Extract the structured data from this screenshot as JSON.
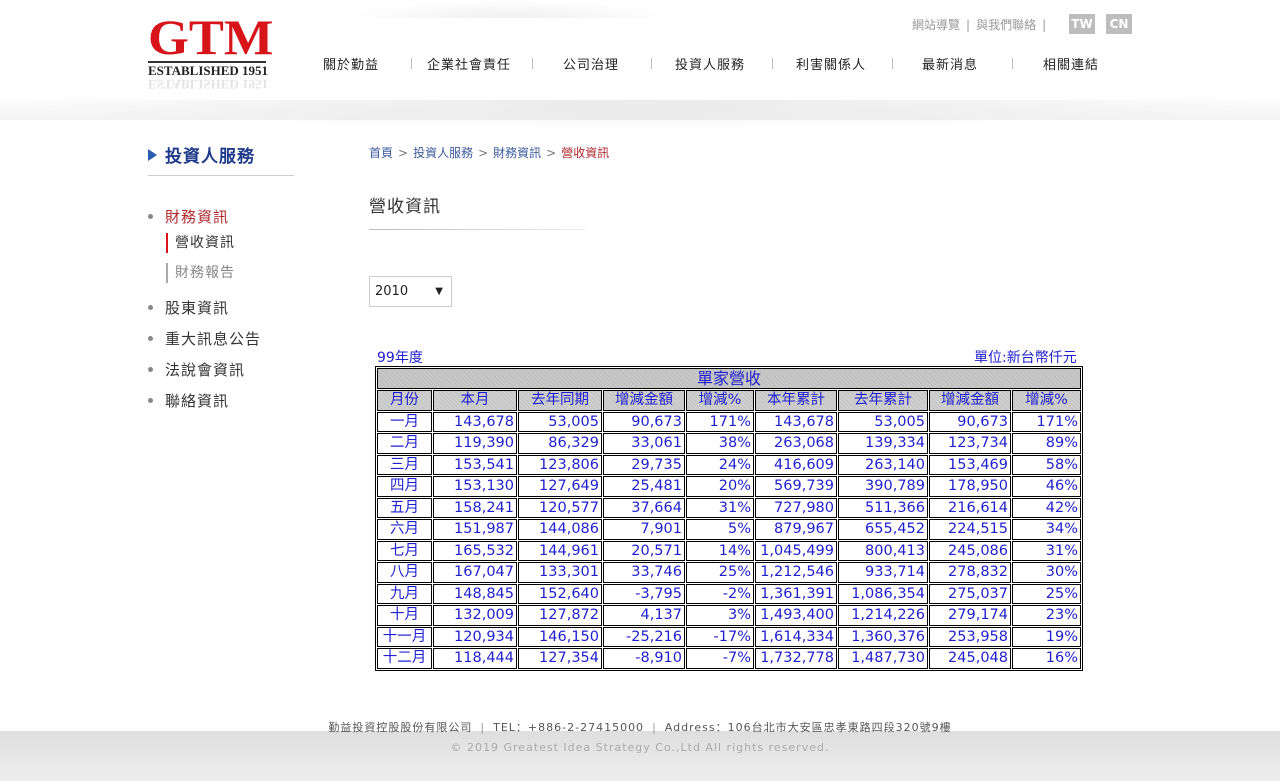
{
  "logo": {
    "text": "GTM",
    "sub": "ESTABLISHED 1951"
  },
  "header": {
    "links": [
      "網站導覽",
      "與我們聯絡"
    ],
    "lang": [
      "TW",
      "CN"
    ],
    "nav": [
      "關於勤益",
      "企業社會責任",
      "公司治理",
      "投資人服務",
      "利害關係人",
      "最新消息",
      "相關連結"
    ]
  },
  "sidebar": {
    "title": "投資人服務",
    "items": [
      {
        "label": "財務資訊"
      },
      {
        "label": "股東資訊"
      },
      {
        "label": "重大訊息公告"
      },
      {
        "label": "法說會資訊"
      },
      {
        "label": "聯絡資訊"
      }
    ],
    "subitems": [
      {
        "label": "營收資訊"
      },
      {
        "label": "財務報告"
      }
    ]
  },
  "breadcrumb": [
    "首頁",
    "投資人服務",
    "財務資訊",
    "營收資訊"
  ],
  "page_title": "營收資訊",
  "year_select": {
    "value": "2010"
  },
  "table": {
    "year_label": "99年度",
    "unit": "單位:新台幣仟元",
    "caption": "單家營收",
    "headers": [
      "月份",
      "本月",
      "去年同期",
      "增減金額",
      "增減%",
      "本年累計",
      "去年累計",
      "增減金額",
      "增減%"
    ],
    "rows": [
      [
        "一月",
        "143,678",
        "53,005",
        "90,673",
        "171%",
        "143,678",
        "53,005",
        "90,673",
        "171%"
      ],
      [
        "二月",
        "119,390",
        "86,329",
        "33,061",
        "38%",
        "263,068",
        "139,334",
        "123,734",
        "89%"
      ],
      [
        "三月",
        "153,541",
        "123,806",
        "29,735",
        "24%",
        "416,609",
        "263,140",
        "153,469",
        "58%"
      ],
      [
        "四月",
        "153,130",
        "127,649",
        "25,481",
        "20%",
        "569,739",
        "390,789",
        "178,950",
        "46%"
      ],
      [
        "五月",
        "158,241",
        "120,577",
        "37,664",
        "31%",
        "727,980",
        "511,366",
        "216,614",
        "42%"
      ],
      [
        "六月",
        "151,987",
        "144,086",
        "7,901",
        "5%",
        "879,967",
        "655,452",
        "224,515",
        "34%"
      ],
      [
        "七月",
        "165,532",
        "144,961",
        "20,571",
        "14%",
        "1,045,499",
        "800,413",
        "245,086",
        "31%"
      ],
      [
        "八月",
        "167,047",
        "133,301",
        "33,746",
        "25%",
        "1,212,546",
        "933,714",
        "278,832",
        "30%"
      ],
      [
        "九月",
        "148,845",
        "152,640",
        "-3,795",
        "-2%",
        "1,361,391",
        "1,086,354",
        "275,037",
        "25%"
      ],
      [
        "十月",
        "132,009",
        "127,872",
        "4,137",
        "3%",
        "1,493,400",
        "1,214,226",
        "279,174",
        "23%"
      ],
      [
        "十一月",
        "120,934",
        "146,150",
        "-25,216",
        "-17%",
        "1,614,334",
        "1,360,376",
        "253,958",
        "19%"
      ],
      [
        "十二月",
        "118,444",
        "127,354",
        "-8,910",
        "-7%",
        "1,732,778",
        "1,487,730",
        "245,048",
        "16%"
      ]
    ]
  },
  "footer": {
    "company": "勤益投資控股股份有限公司",
    "tel": "TEL：+886-2-27415000",
    "address": "Address：106台北市大安區忠孝東路四段320號9樓",
    "copyright": "© 2019 Greatest Idea Strategy Co.,Ltd All rights reserved."
  },
  "colors": {
    "brand_red": "#d7141a",
    "link_blue": "#1f1fd0",
    "nav_blue": "#1e3a8a"
  }
}
